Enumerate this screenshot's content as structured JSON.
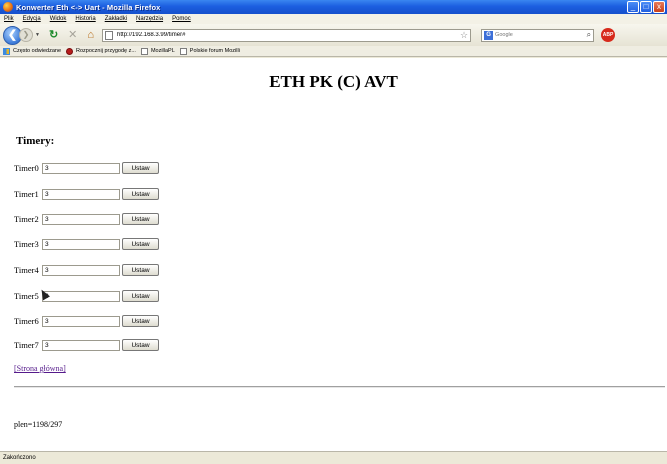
{
  "window": {
    "title": "Konwerter Eth <-> Uart - Mozilla Firefox",
    "minimize": "_",
    "maximize": "□",
    "close": "x"
  },
  "menu": [
    "Plik",
    "Edycja",
    "Widok",
    "Historia",
    "Zakładki",
    "Narzędzia",
    "Pomoc"
  ],
  "nav": {
    "url": "http://192.168.3.99/timer#",
    "search_placeholder": "Google",
    "abp_label": "ABP"
  },
  "bookmarks": [
    "Często odwiedzane",
    "Rozpocznij przygodę z...",
    "MozillaPL",
    "Polskie forum Mozilli"
  ],
  "page": {
    "heading": "ETH PK (C) AVT",
    "subheading": "Timery:",
    "timers": [
      {
        "label": "Timer0",
        "value": "3",
        "button": "Ustaw"
      },
      {
        "label": "Timer1",
        "value": "3",
        "button": "Ustaw"
      },
      {
        "label": "Timer2",
        "value": "3",
        "button": "Ustaw"
      },
      {
        "label": "Timer3",
        "value": "3",
        "button": "Ustaw"
      },
      {
        "label": "Timer4",
        "value": "3",
        "button": "Ustaw"
      },
      {
        "label": "Timer5",
        "value": "3",
        "button": "Ustaw"
      },
      {
        "label": "Timer6",
        "value": "3",
        "button": "Ustaw"
      },
      {
        "label": "Timer7",
        "value": "3",
        "button": "Ustaw"
      }
    ],
    "home_link": "[Strona główna]",
    "plen": "plen=1198/297"
  },
  "status": "Zakończono",
  "colors": {
    "titlebar": "#1c5ee0",
    "link": "#551a8b"
  }
}
